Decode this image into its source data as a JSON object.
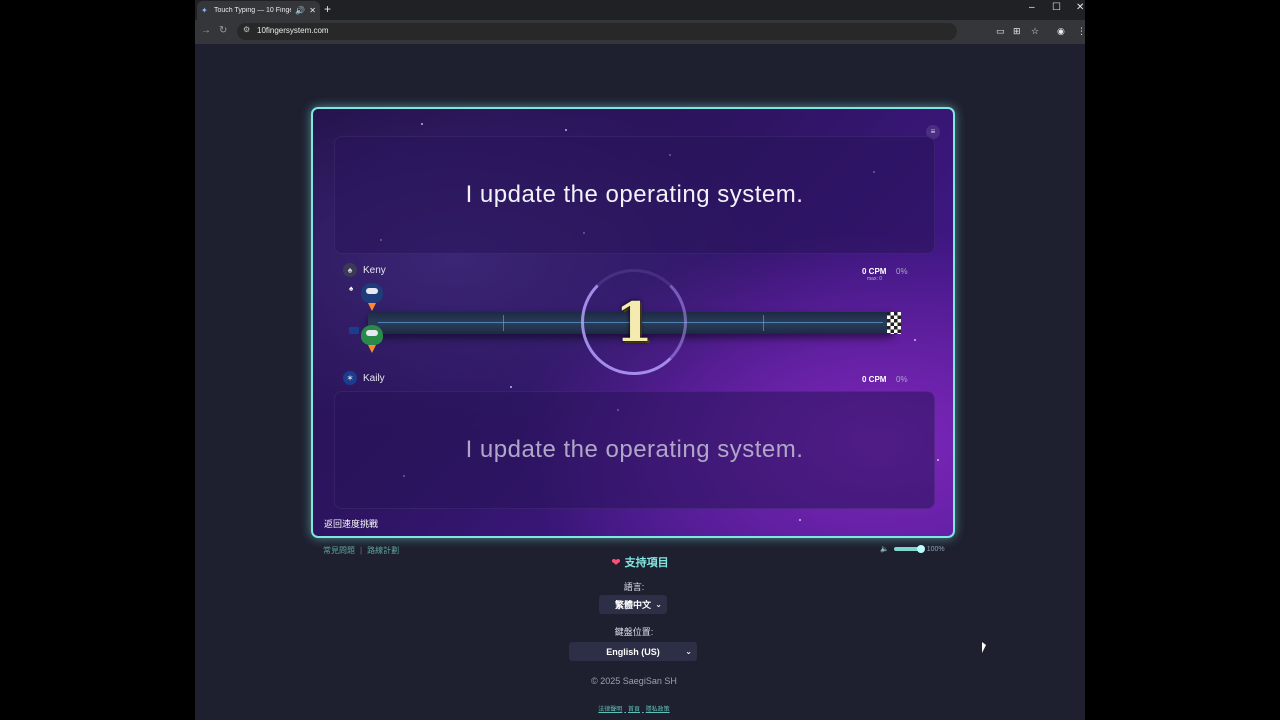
{
  "browser": {
    "tab_title": "Touch Typing — 10 Finger",
    "url": "10fingersystem.com",
    "new_tab_label": "+",
    "min_label": "–",
    "max_label": "☐",
    "close_label": "✕"
  },
  "game": {
    "typed_text": "I update the operating system.",
    "target_text": "I update the operating system.",
    "countdown": "1",
    "back_label": "返回速度挑戰",
    "players": [
      {
        "name": "Keny",
        "cpm": "0 CPM",
        "percent": "0%",
        "max": "max: 0"
      },
      {
        "name": "Kaily",
        "cpm": "0 CPM",
        "percent": "0%"
      }
    ]
  },
  "footer": {
    "faq_label": "常見問題",
    "roadmap_label": "路線計劃",
    "volume_label": "100%",
    "support_label": "支持項目",
    "language_label": "語言:",
    "language_value": "繁體中文",
    "keyboard_label": "鍵盤位置:",
    "keyboard_value": "English (US)",
    "copyright": "© 2025 SaegiSan SH",
    "links": [
      "法律聲明",
      "首頁",
      "隱私政策"
    ]
  },
  "colors": {
    "accent": "#7fe7e0",
    "background": "#1e2030"
  }
}
